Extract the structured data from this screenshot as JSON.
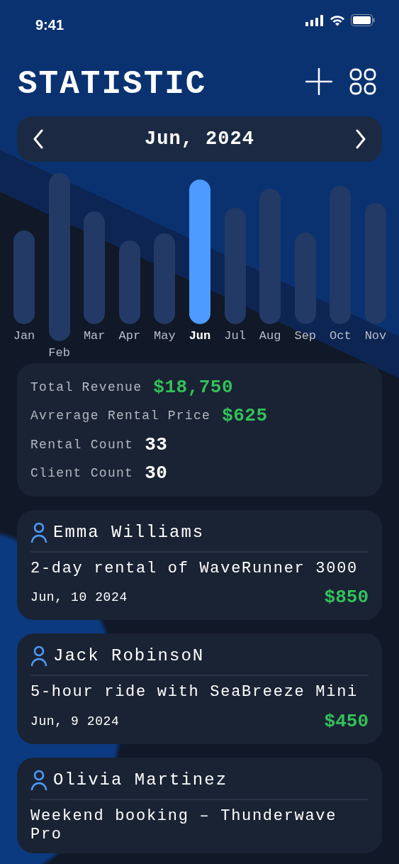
{
  "status_bar": {
    "time": "9:41"
  },
  "header": {
    "title": "STATISTIC"
  },
  "month_selector": {
    "label": "Jun, 2024"
  },
  "months": [
    {
      "label": "Jan",
      "selected": false
    },
    {
      "label": "Feb",
      "selected": false
    },
    {
      "label": "Mar",
      "selected": false
    },
    {
      "label": "Apr",
      "selected": false
    },
    {
      "label": "May",
      "selected": false
    },
    {
      "label": "Jun",
      "selected": true
    },
    {
      "label": "Jul",
      "selected": false
    },
    {
      "label": "Aug",
      "selected": false
    },
    {
      "label": "Sep",
      "selected": false
    },
    {
      "label": "Oct",
      "selected": false
    },
    {
      "label": "Nov",
      "selected": false
    }
  ],
  "stats": [
    {
      "label": "Total Revenue",
      "value": "$18,750",
      "kind": "money"
    },
    {
      "label": "Avrerage Rental Price",
      "value": "$625",
      "kind": "money"
    },
    {
      "label": "Rental Count",
      "value": "33",
      "kind": "count"
    },
    {
      "label": "Client Count",
      "value": "30",
      "kind": "count"
    }
  ],
  "rentals": [
    {
      "client": "Emma Williams",
      "description": "2-day rental of WaveRunner 3000",
      "date": "Jun, 10 2024",
      "amount": "$850"
    },
    {
      "client": "Jack RobinsoN",
      "description": "5-hour ride with SeaBreeze Mini",
      "date": "Jun, 9 2024",
      "amount": "$450"
    },
    {
      "client": "Olivia Martinez",
      "description": "Weekend booking – Thunderwave Pro"
    }
  ]
}
